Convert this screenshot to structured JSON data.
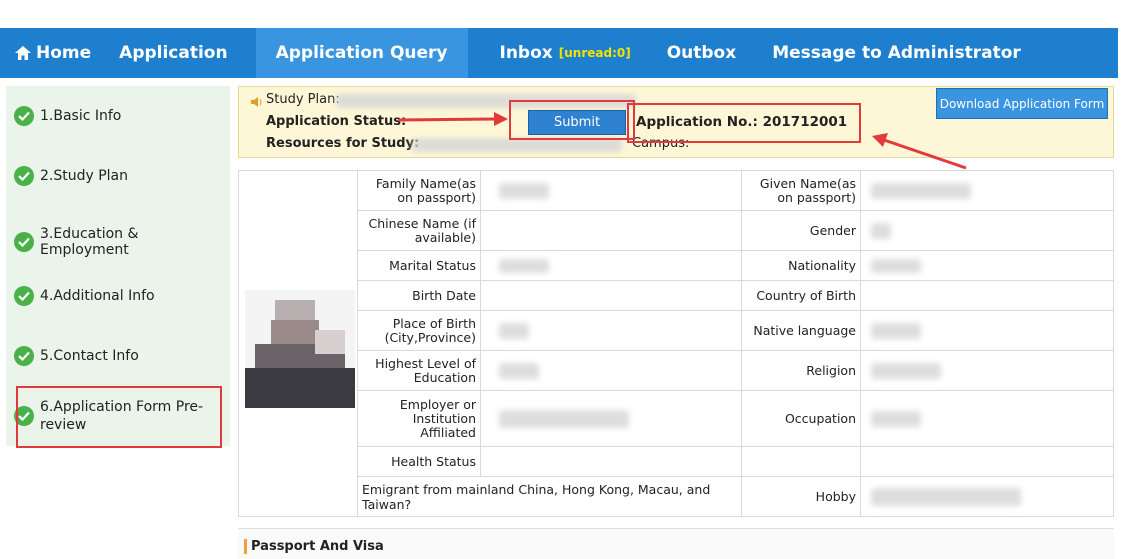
{
  "nav": {
    "home": "Home",
    "application": "Application",
    "query": "Application Query",
    "inbox": "Inbox",
    "unread": "[unread:0]",
    "outbox": "Outbox",
    "message": "Message to Administrator"
  },
  "sidebar": {
    "items": [
      {
        "label": "1.Basic Info"
      },
      {
        "label": "2.Study Plan"
      },
      {
        "label": "3.Education & Employment"
      },
      {
        "label": "4.Additional Info"
      },
      {
        "label": "5.Contact Info"
      },
      {
        "label": "6.Application Form Pre-review"
      }
    ]
  },
  "status": {
    "study_plan_label": "Study Plan:",
    "app_status_label": "Application Status:",
    "resources_label": "Resources for Study:",
    "submit_label": "Submit",
    "app_no_label": "Application No.:",
    "app_no_value": "201712001",
    "campus_label": "Campus:",
    "download_label": "Download Application Form"
  },
  "form": {
    "family_name": "Family Name(as on passport)",
    "given_name": "Given Name(as on passport)",
    "chinese_name": "Chinese Name (if available)",
    "gender": "Gender",
    "marital": "Marital Status",
    "nationality": "Nationality",
    "birth_date": "Birth Date",
    "country_birth": "Country of Birth",
    "place_birth": "Place of Birth (City,Province)",
    "native_lang": "Native language",
    "highest_edu": "Highest Level of Education",
    "religion": "Religion",
    "employer": "Employer or Institution Affiliated",
    "occupation": "Occupation",
    "health": "Health Status",
    "emigrant": "Emigrant from mainland China, Hong Kong, Macau, and Taiwan?",
    "hobby": "Hobby"
  },
  "section": {
    "passport": "Passport And Visa"
  },
  "colors": {
    "nav_bg": "#1f7fcf",
    "nav_active": "#3a95e0",
    "highlight_red": "#e03a3a",
    "check_green": "#4ab04a"
  }
}
